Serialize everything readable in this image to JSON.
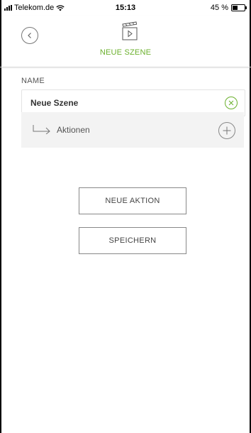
{
  "status_bar": {
    "carrier": "Telekom.de",
    "time": "15:13",
    "battery": "45 %",
    "battery_level": 0.45
  },
  "header": {
    "title": "NEUE SZENE",
    "back_icon": "chevron-left-circle-icon",
    "scene_icon": "clapperboard-play-icon"
  },
  "name_section": {
    "label": "NAME",
    "value": "Neue Szene",
    "clear_icon": "clear-circle-icon"
  },
  "actions": {
    "label": "Aktionen",
    "arrow_icon": "arrow-right-icon",
    "add_icon": "plus-circle-icon"
  },
  "buttons": {
    "new_action": "NEUE AKTION",
    "save": "SPEICHERN"
  },
  "colors": {
    "accent": "#6bb02d",
    "border": "#888888",
    "row_background": "#f3f3f3"
  }
}
